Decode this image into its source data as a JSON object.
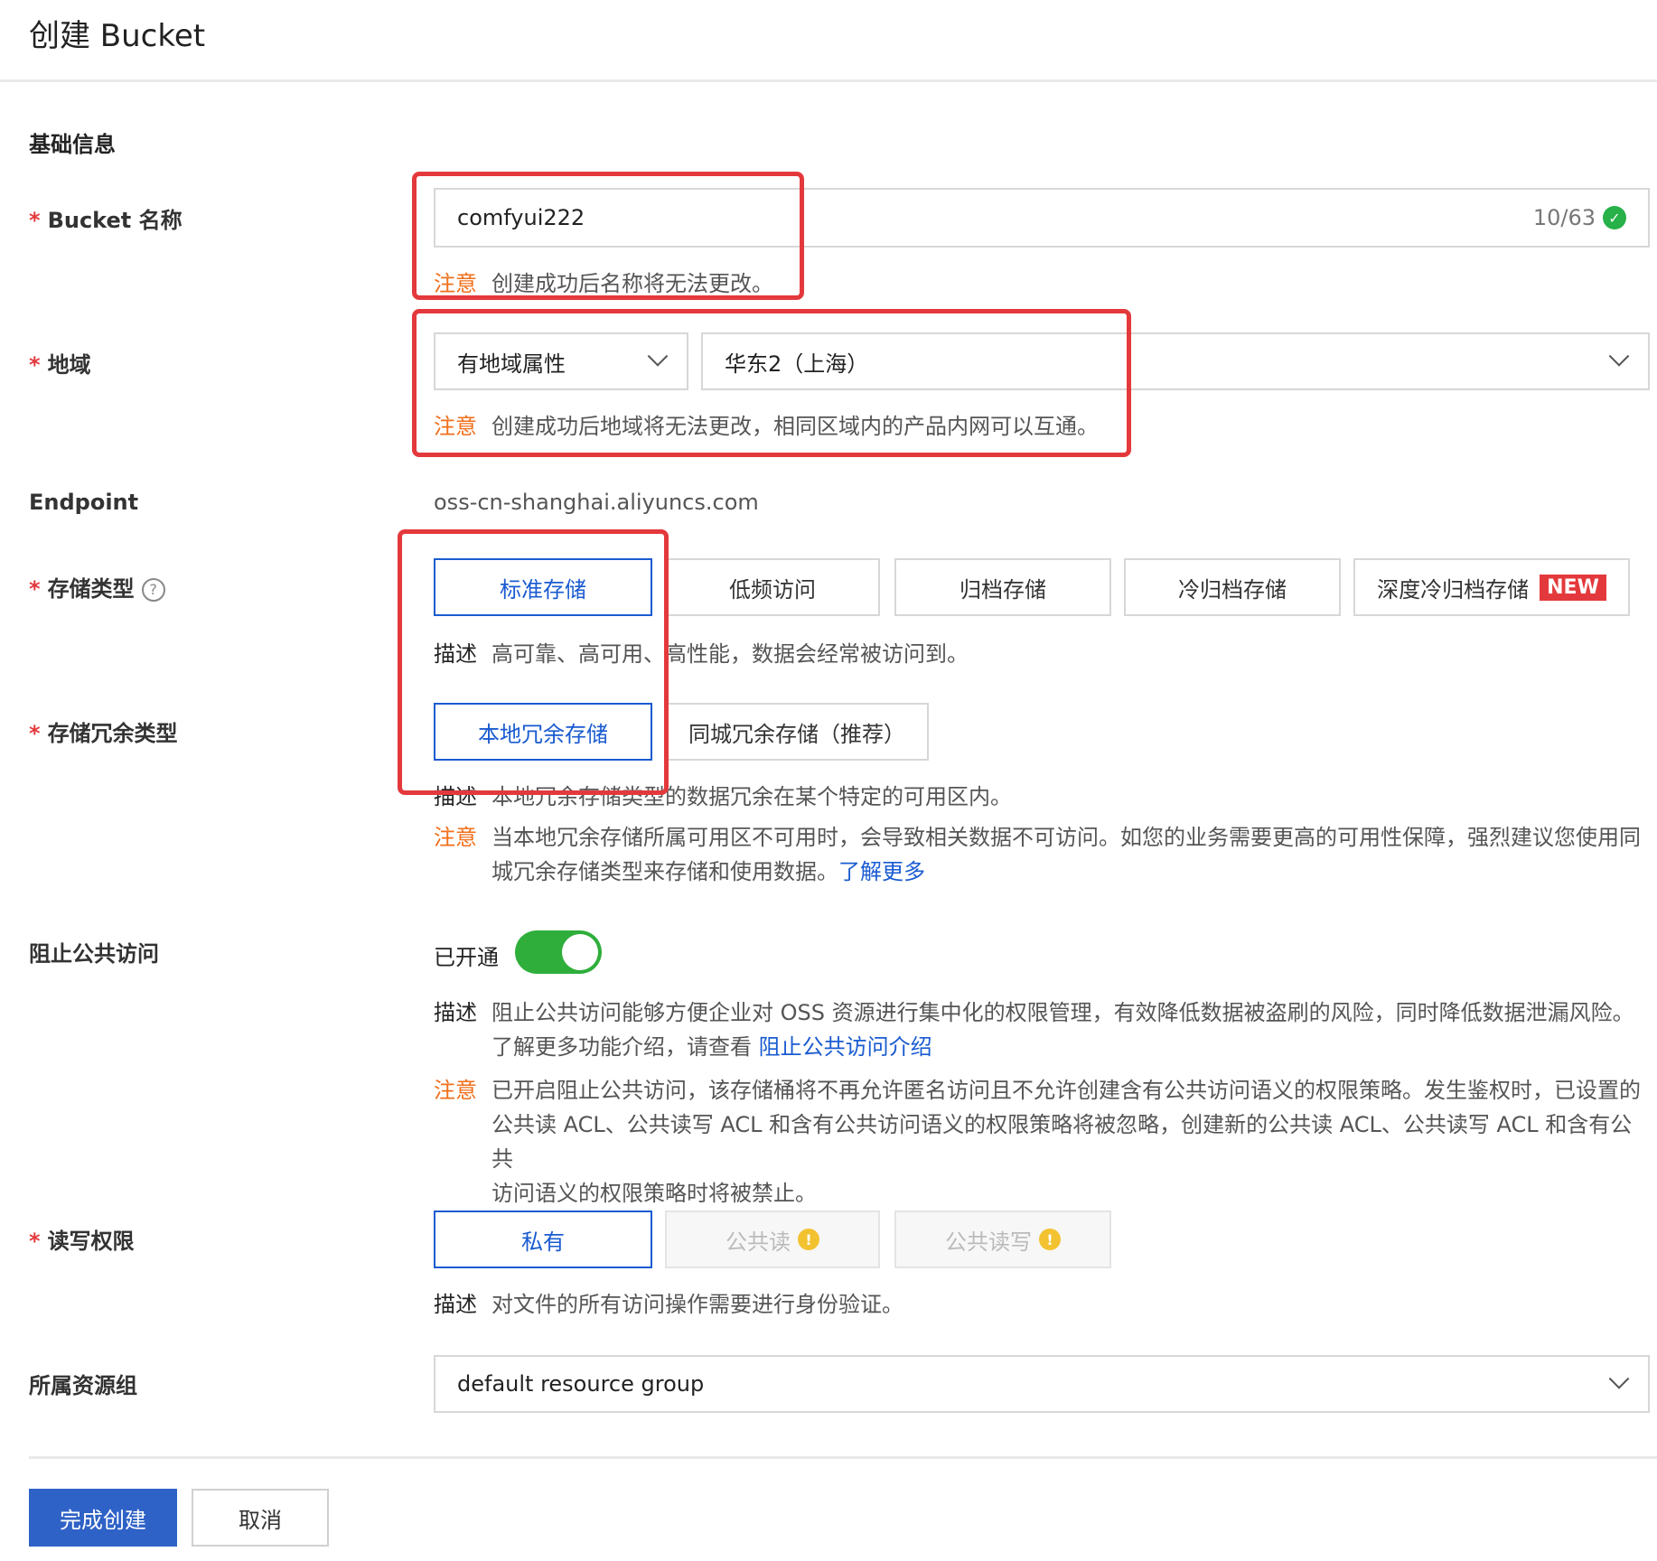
{
  "header": {
    "title": "创建 Bucket"
  },
  "section_basic": "基础信息",
  "bucket_name": {
    "label": "Bucket 名称",
    "value": "comfyui222",
    "counter": "10/63",
    "note_tag": "注意",
    "note": "创建成功后名称将无法更改。"
  },
  "region": {
    "label": "地域",
    "type_select": "有地域属性",
    "region_select": "华东2（上海）",
    "note_tag": "注意",
    "note": "创建成功后地域将无法更改，相同区域内的产品内网可以互通。"
  },
  "endpoint": {
    "label": "Endpoint",
    "value": "oss-cn-shanghai.aliyuncs.com"
  },
  "storage_type": {
    "label": "存储类型",
    "options": [
      "标准存储",
      "低频访问",
      "归档存储",
      "冷归档存储",
      "深度冷归档存储"
    ],
    "new_badge": "NEW",
    "desc_tag": "描述",
    "desc": "高可靠、高可用、高性能，数据会经常被访问到。"
  },
  "redundancy": {
    "label": "存储冗余类型",
    "options": [
      "本地冗余存储",
      "同城冗余存储（推荐）"
    ],
    "desc_tag": "描述",
    "desc": "本地冗余存储类型的数据冗余在某个特定的可用区内。",
    "note_tag": "注意",
    "note_line1": "当本地冗余存储所属可用区不可用时，会导致相关数据不可访问。如您的业务需要更高的可用性保障，强烈建议您使用同",
    "note_line2": "城冗余存储类型来存储和使用数据。",
    "learn_more": "了解更多"
  },
  "block_public": {
    "label": "阻止公共访问",
    "toggle_label": "已开通",
    "desc_tag": "描述",
    "desc_line1": "阻止公共访问能够方便企业对 OSS 资源进行集中化的权限管理，有效降低数据被盗刷的风险，同时降低数据泄漏风险。",
    "desc_line2": "了解更多功能介绍，请查看",
    "desc_link": "阻止公共访问介绍",
    "note_tag": "注意",
    "note_line1": "已开启阻止公共访问，该存储桶将不再允许匿名访问且不允许创建含有公共访问语义的权限策略。发生鉴权时，已设置的",
    "note_line2": "公共读 ACL、公共读写 ACL 和含有公共访问语义的权限策略将被忽略，创建新的公共读 ACL、公共读写 ACL 和含有公共",
    "note_line3": "访问语义的权限策略时将被禁止。"
  },
  "acl": {
    "label": "读写权限",
    "options": [
      "私有",
      "公共读",
      "公共读写"
    ],
    "desc_tag": "描述",
    "desc": "对文件的所有访问操作需要进行身份验证。"
  },
  "resource_group": {
    "label": "所属资源组",
    "value": "default resource group"
  },
  "footer": {
    "submit": "完成创建",
    "cancel": "取消"
  },
  "colors": {
    "accent": "#1a5bd1",
    "warning": "#f06f1a",
    "required": "#e4393c",
    "toggle_on": "#2fae3b",
    "highlight_box": "#e4393c"
  }
}
